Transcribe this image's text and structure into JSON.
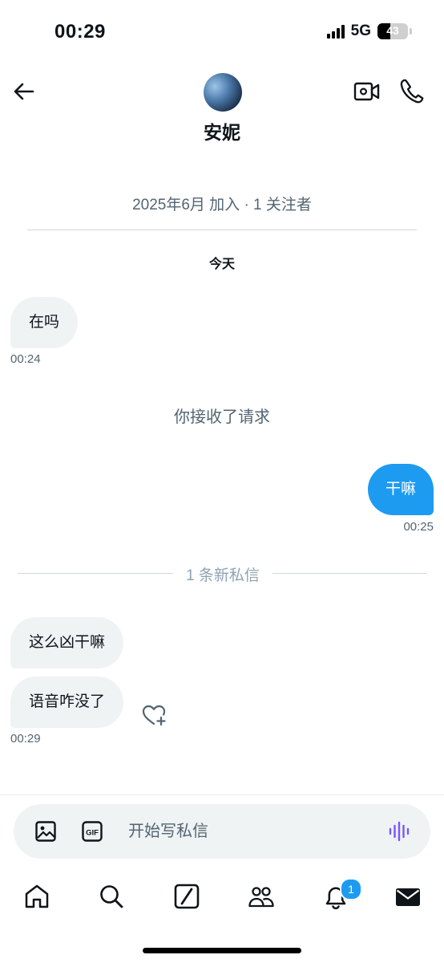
{
  "status_bar": {
    "time": "00:29",
    "network": "5G",
    "battery_level": "43",
    "battery_fraction": 0.43
  },
  "header": {
    "contact_name": "安妮"
  },
  "profile_info": "2025年6月 加入 · 1 关注者",
  "day_label": "今天",
  "messages": [
    {
      "text": "在吗",
      "time": "00:24"
    },
    {
      "text": "干嘛",
      "time": "00:25"
    },
    {
      "text": "这么凶干嘛"
    },
    {
      "text": "语音咋没了",
      "time": "00:29"
    }
  ],
  "system_message": "你接收了请求",
  "new_messages_divider": "1 条新私信",
  "composer": {
    "placeholder": "开始写私信"
  },
  "nav": {
    "notification_badge": "1"
  },
  "colors": {
    "accent": "#1d9bf0",
    "voice": "#7856ff",
    "incoming_bubble": "#eff3f4",
    "muted_text": "#536471"
  }
}
